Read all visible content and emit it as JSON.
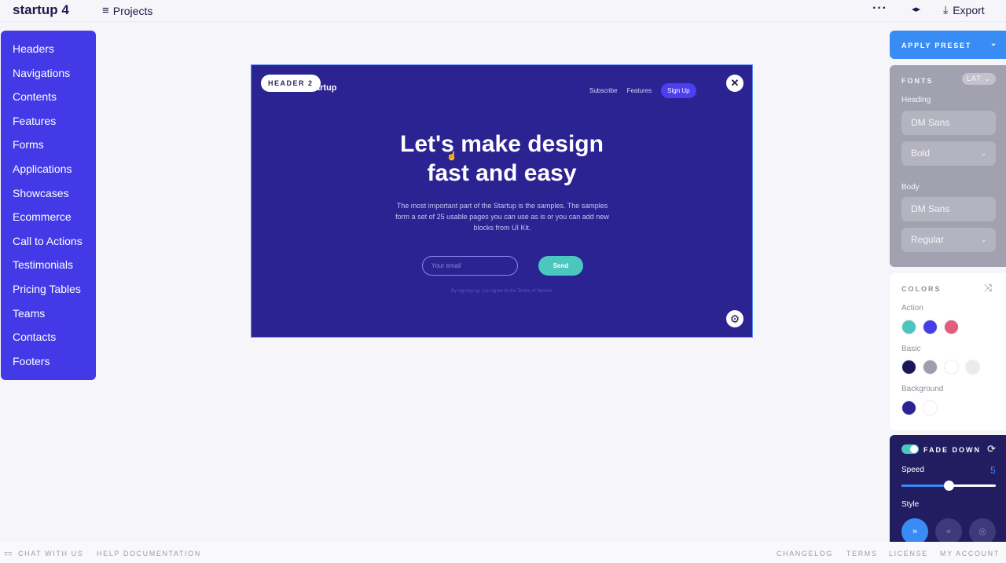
{
  "topbar": {
    "brand": "startup 4",
    "projects_icon": "≡",
    "projects_label": "Projects",
    "more_icon": "···",
    "split_icon": "◂▸",
    "export_icon": "⤓",
    "export_label": "Export"
  },
  "sidebar": {
    "items": [
      {
        "label": "Headers"
      },
      {
        "label": "Navigations"
      },
      {
        "label": "Contents"
      },
      {
        "label": "Features"
      },
      {
        "label": "Forms"
      },
      {
        "label": "Applications"
      },
      {
        "label": "Showcases"
      },
      {
        "label": "Ecommerce"
      },
      {
        "label": "Call to Actions"
      },
      {
        "label": "Testimonials"
      },
      {
        "label": "Pricing Tables"
      },
      {
        "label": "Teams"
      },
      {
        "label": "Contacts"
      },
      {
        "label": "Footers"
      }
    ]
  },
  "preview": {
    "badge": "HEADER 2",
    "logo": "Startup",
    "nav": [
      "Subscribe",
      "Features",
      "Sign Up"
    ],
    "close_icon": "✕",
    "heading_line1": "Let's make design",
    "heading_line2": "fast and easy",
    "description": "The most important part of the Startup is the samples. The samples form a set of 25 usable pages you can use as is or you can add new blocks from UI Kit.",
    "email_placeholder": "Your email",
    "send_label": "Send",
    "terms": "By signing up, you agree to the Terms of Service",
    "settings_icon": "⚙"
  },
  "panel": {
    "preset_label": "APPLY PRESET",
    "chevron": "⌄",
    "fonts": {
      "title": "FONTS",
      "charset": "LAT",
      "heading_label": "Heading",
      "heading_font": "DM Sans",
      "heading_weight": "Bold",
      "body_label": "Body",
      "body_font": "DM Sans",
      "body_weight": "Regular"
    },
    "colors": {
      "title": "COLORS",
      "shuffle_icon": "⤨",
      "action_label": "Action",
      "action": [
        "#4ac6bf",
        "#453de6",
        "#e55d7c"
      ],
      "basic_label": "Basic",
      "basic": [
        "#1a165a",
        "#9d9fae",
        "#ffffff",
        "#ebebef"
      ],
      "background_label": "Background",
      "background": [
        "#2c2393",
        "#ffffff"
      ]
    },
    "animation": {
      "enabled": true,
      "title": "FADE DOWN",
      "refresh_icon": "⟳",
      "speed_label": "Speed",
      "speed_value": "5",
      "speed_fraction": 0.5,
      "style_label": "Style",
      "styles": [
        {
          "icon": "»",
          "active": true
        },
        {
          "icon": "«",
          "active": false
        },
        {
          "icon": "◎",
          "active": false
        }
      ]
    }
  },
  "footer": {
    "chat_icon": "▭",
    "chat": "CHAT WITH US",
    "help": "HELP DOCUMENTATION",
    "changelog": "CHANGELOG",
    "terms": "TERMS",
    "license": "LICENSE",
    "account": "MY ACCOUNT"
  }
}
